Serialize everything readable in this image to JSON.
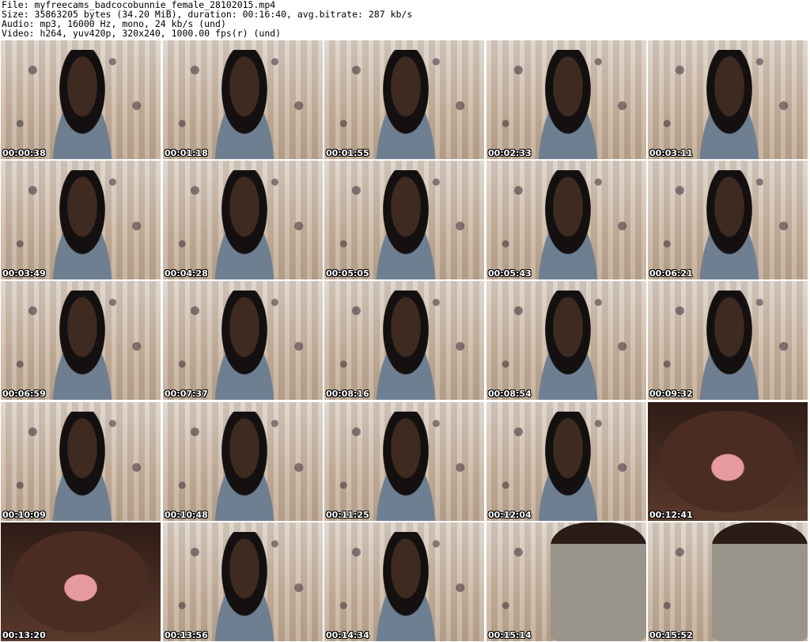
{
  "header": {
    "file_line": "File: myfreecams_badcocobunnie_female_28102015.mp4",
    "size_line": "Size: 35863205 bytes (34.20 MiB), duration: 00:16:40, avg.bitrate: 287 kb/s",
    "audio_line": "Audio: mp3, 16000 Hz, mono, 24 kb/s (und)",
    "video_line": "Video: h264, yuv420p, 320x240, 1000.00 fps(r) (und)"
  },
  "thumbnails": [
    {
      "timestamp": "00:00:38",
      "kind": "person"
    },
    {
      "timestamp": "00:01:18",
      "kind": "person"
    },
    {
      "timestamp": "00:01:55",
      "kind": "person"
    },
    {
      "timestamp": "00:02:33",
      "kind": "person"
    },
    {
      "timestamp": "00:03:11",
      "kind": "person"
    },
    {
      "timestamp": "00:03:49",
      "kind": "person"
    },
    {
      "timestamp": "00:04:28",
      "kind": "person"
    },
    {
      "timestamp": "00:05:05",
      "kind": "person"
    },
    {
      "timestamp": "00:05:43",
      "kind": "person"
    },
    {
      "timestamp": "00:06:21",
      "kind": "person"
    },
    {
      "timestamp": "00:06:59",
      "kind": "person"
    },
    {
      "timestamp": "00:07:37",
      "kind": "person"
    },
    {
      "timestamp": "00:08:16",
      "kind": "person"
    },
    {
      "timestamp": "00:08:54",
      "kind": "person"
    },
    {
      "timestamp": "00:09:32",
      "kind": "person"
    },
    {
      "timestamp": "00:10:09",
      "kind": "person"
    },
    {
      "timestamp": "00:10:48",
      "kind": "person"
    },
    {
      "timestamp": "00:11:25",
      "kind": "person"
    },
    {
      "timestamp": "00:12:04",
      "kind": "person"
    },
    {
      "timestamp": "00:12:41",
      "kind": "closeup"
    },
    {
      "timestamp": "00:13:20",
      "kind": "closeup"
    },
    {
      "timestamp": "00:13:56",
      "kind": "person"
    },
    {
      "timestamp": "00:14:34",
      "kind": "person"
    },
    {
      "timestamp": "00:15:14",
      "kind": "pants"
    },
    {
      "timestamp": "00:15:52",
      "kind": "pants"
    }
  ]
}
